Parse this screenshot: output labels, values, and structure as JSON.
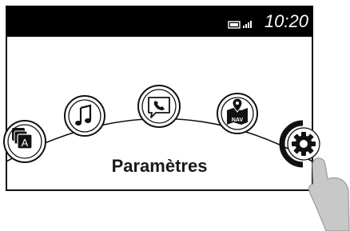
{
  "status_bar": {
    "time": "10:20",
    "battery_icon": "battery-icon",
    "signal_icon": "signal-bars-icon"
  },
  "menu": {
    "selected_label": "Paramètres",
    "items": [
      {
        "id": "apps",
        "icon": "apps-stack-icon",
        "letter": "A"
      },
      {
        "id": "music",
        "icon": "music-note-icon"
      },
      {
        "id": "phone",
        "icon": "phone-message-icon"
      },
      {
        "id": "navigation",
        "icon": "navigation-map-icon",
        "badge": "NAV"
      },
      {
        "id": "settings",
        "icon": "gear-icon",
        "selected": true
      }
    ]
  },
  "gesture": {
    "icon": "tapping-finger-icon"
  }
}
